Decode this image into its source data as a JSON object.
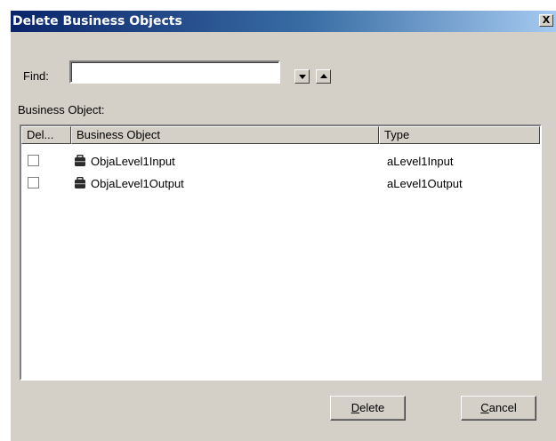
{
  "window": {
    "title": "Delete Business Objects",
    "close_glyph": "X"
  },
  "find": {
    "label": "Find:",
    "value": ""
  },
  "list": {
    "label": "Business Object:",
    "columns": [
      "Del...",
      "Business Object",
      "Type"
    ],
    "rows": [
      {
        "checked": false,
        "icon": "business-object-icon",
        "name": "ObjaLevel1Input",
        "type": "aLevel1Input"
      },
      {
        "checked": false,
        "icon": "business-object-icon",
        "name": "ObjaLevel1Output",
        "type": "aLevel1Output"
      }
    ]
  },
  "buttons": {
    "delete": {
      "mnemonic": "D",
      "rest": "elete"
    },
    "cancel": {
      "mnemonic": "C",
      "rest": "ancel"
    }
  }
}
